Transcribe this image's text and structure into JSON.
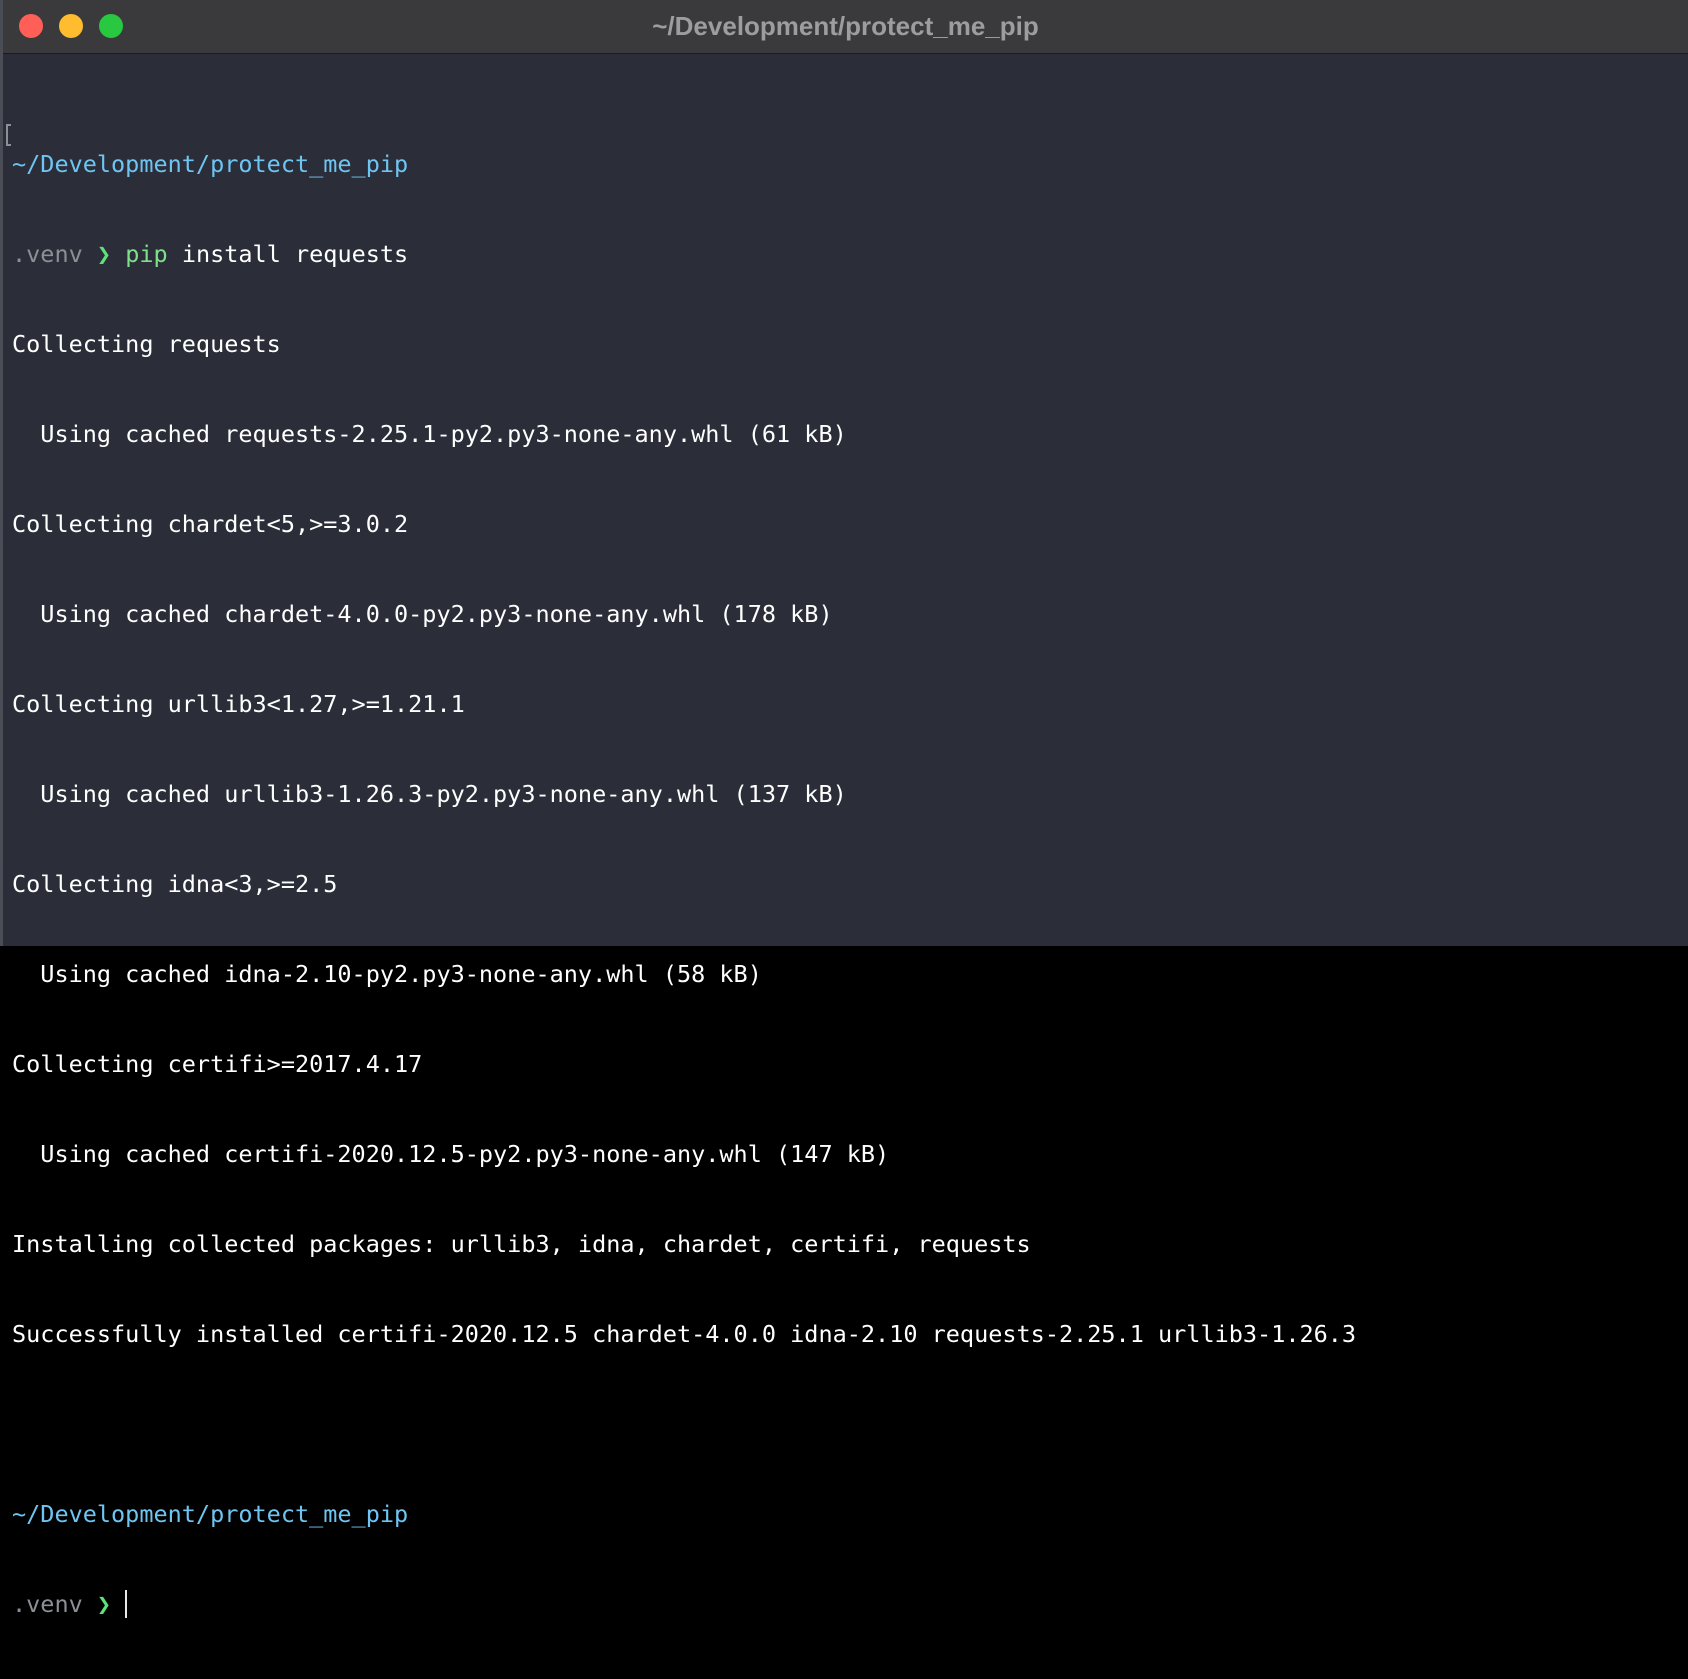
{
  "window": {
    "title": "~/Development/protect_me_pip"
  },
  "terminal": {
    "prompt1": {
      "path": "~/Development/protect_me_pip",
      "venv": ".venv",
      "arrow": "❯",
      "command_name": "pip",
      "command_args": " install requests"
    },
    "output": [
      "Collecting requests",
      "  Using cached requests-2.25.1-py2.py3-none-any.whl (61 kB)",
      "Collecting chardet<5,>=3.0.2",
      "  Using cached chardet-4.0.0-py2.py3-none-any.whl (178 kB)",
      "Collecting urllib3<1.27,>=1.21.1",
      "  Using cached urllib3-1.26.3-py2.py3-none-any.whl (137 kB)",
      "Collecting idna<3,>=2.5",
      "  Using cached idna-2.10-py2.py3-none-any.whl (58 kB)",
      "Collecting certifi>=2017.4.17",
      "  Using cached certifi-2020.12.5-py2.py3-none-any.whl (147 kB)",
      "Installing collected packages: urllib3, idna, chardet, certifi, requests",
      "Successfully installed certifi-2020.12.5 chardet-4.0.0 idna-2.10 requests-2.25.1 urllib3-1.26.3"
    ],
    "prompt2": {
      "path": "~/Development/protect_me_pip",
      "venv": ".venv",
      "arrow": "❯"
    }
  },
  "colors": {
    "background": "#2b2e38",
    "path": "#6fc5f2",
    "arrow": "#5ee07a",
    "text": "#ffffff"
  }
}
